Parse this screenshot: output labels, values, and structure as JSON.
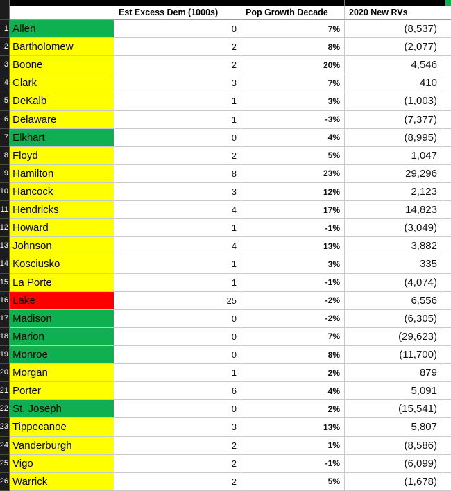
{
  "sheet": {
    "columns": {
      "row_number_header": "",
      "name": "",
      "dem": "Est Excess Dem (1000s)",
      "pop": "Pop Growth Decade",
      "rv": "2020 New RVs"
    },
    "colors": {
      "green": "#0FB050",
      "yellow": "#FFFF00",
      "red": "#FF0000",
      "gutter": "#1c1c1c",
      "gridline": "#c9c9c9",
      "header_band": "#000000"
    },
    "rows": [
      {
        "num": "1",
        "name": "Allen",
        "fill": "green",
        "dem": "0",
        "pop": "7%",
        "rv": "(8,537)"
      },
      {
        "num": "2",
        "name": "Bartholomew",
        "fill": "yellow",
        "dem": "2",
        "pop": "8%",
        "rv": "(2,077)"
      },
      {
        "num": "3",
        "name": "Boone",
        "fill": "yellow",
        "dem": "2",
        "pop": "20%",
        "rv": "4,546"
      },
      {
        "num": "4",
        "name": "Clark",
        "fill": "yellow",
        "dem": "3",
        "pop": "7%",
        "rv": "410"
      },
      {
        "num": "5",
        "name": "DeKalb",
        "fill": "yellow",
        "dem": "1",
        "pop": "3%",
        "rv": "(1,003)"
      },
      {
        "num": "6",
        "name": "Delaware",
        "fill": "yellow",
        "dem": "1",
        "pop": "-3%",
        "rv": "(7,377)"
      },
      {
        "num": "7",
        "name": "Elkhart",
        "fill": "green",
        "dem": "0",
        "pop": "4%",
        "rv": "(8,995)"
      },
      {
        "num": "8",
        "name": "Floyd",
        "fill": "yellow",
        "dem": "2",
        "pop": "5%",
        "rv": "1,047"
      },
      {
        "num": "9",
        "name": "Hamilton",
        "fill": "yellow",
        "dem": "8",
        "pop": "23%",
        "rv": "29,296"
      },
      {
        "num": "10",
        "name": "Hancock",
        "fill": "yellow",
        "dem": "3",
        "pop": "12%",
        "rv": "2,123"
      },
      {
        "num": "11",
        "name": "Hendricks",
        "fill": "yellow",
        "dem": "4",
        "pop": "17%",
        "rv": "14,823"
      },
      {
        "num": "12",
        "name": "Howard",
        "fill": "yellow",
        "dem": "1",
        "pop": "-1%",
        "rv": "(3,049)"
      },
      {
        "num": "13",
        "name": "Johnson",
        "fill": "yellow",
        "dem": "4",
        "pop": "13%",
        "rv": "3,882"
      },
      {
        "num": "14",
        "name": "Kosciusko",
        "fill": "yellow",
        "dem": "1",
        "pop": "3%",
        "rv": "335"
      },
      {
        "num": "15",
        "name": "La Porte",
        "fill": "yellow",
        "dem": "1",
        "pop": "-1%",
        "rv": "(4,074)"
      },
      {
        "num": "16",
        "name": "Lake",
        "fill": "red",
        "dem": "25",
        "pop": "-2%",
        "rv": "6,556"
      },
      {
        "num": "17",
        "name": "Madison",
        "fill": "green",
        "dem": "0",
        "pop": "-2%",
        "rv": "(6,305)"
      },
      {
        "num": "18",
        "name": "Marion",
        "fill": "green",
        "dem": "0",
        "pop": "7%",
        "rv": "(29,623)"
      },
      {
        "num": "19",
        "name": "Monroe",
        "fill": "green",
        "dem": "0",
        "pop": "8%",
        "rv": "(11,700)"
      },
      {
        "num": "20",
        "name": "Morgan",
        "fill": "yellow",
        "dem": "1",
        "pop": "2%",
        "rv": "879"
      },
      {
        "num": "21",
        "name": "Porter",
        "fill": "yellow",
        "dem": "6",
        "pop": "4%",
        "rv": "5,091"
      },
      {
        "num": "22",
        "name": "St. Joseph",
        "fill": "green",
        "dem": "0",
        "pop": "2%",
        "rv": "(15,541)"
      },
      {
        "num": "23",
        "name": "Tippecanoe",
        "fill": "yellow",
        "dem": "3",
        "pop": "13%",
        "rv": "5,807"
      },
      {
        "num": "24",
        "name": "Vanderburgh",
        "fill": "yellow",
        "dem": "2",
        "pop": "1%",
        "rv": "(8,586)"
      },
      {
        "num": "25",
        "name": "Vigo",
        "fill": "yellow",
        "dem": "2",
        "pop": "-1%",
        "rv": "(6,099)"
      },
      {
        "num": "26",
        "name": "Warrick",
        "fill": "yellow",
        "dem": "2",
        "pop": "5%",
        "rv": "(1,678)"
      }
    ]
  }
}
